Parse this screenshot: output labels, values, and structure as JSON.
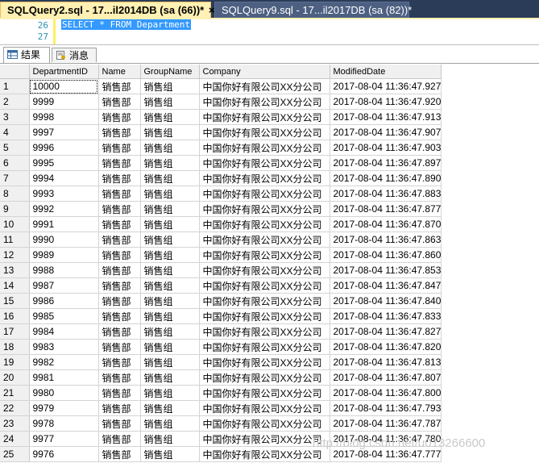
{
  "tabs": {
    "active": {
      "title": "SQLQuery2.sql - 17...il2014DB (sa (66))*",
      "close": "×"
    },
    "inactive": {
      "title": "SQLQuery9.sql - 17...il2017DB (sa (82))*"
    }
  },
  "editor": {
    "lines": [
      {
        "number": "26",
        "text": "SELECT * FROM Department"
      },
      {
        "number": "27",
        "text": ""
      }
    ]
  },
  "result_tabs": [
    {
      "label": "结果",
      "icon": "grid-icon"
    },
    {
      "label": "消息",
      "icon": "messages-icon"
    }
  ],
  "grid": {
    "columns": [
      "",
      "DepartmentID",
      "Name",
      "GroupName",
      "Company",
      "ModifiedDate"
    ],
    "rows": [
      [
        "1",
        "10000",
        "销售部",
        "销售组",
        "中国你好有限公司XX分公司",
        "2017-08-04 11:36:47.927"
      ],
      [
        "2",
        "9999",
        "销售部",
        "销售组",
        "中国你好有限公司XX分公司",
        "2017-08-04 11:36:47.920"
      ],
      [
        "3",
        "9998",
        "销售部",
        "销售组",
        "中国你好有限公司XX分公司",
        "2017-08-04 11:36:47.913"
      ],
      [
        "4",
        "9997",
        "销售部",
        "销售组",
        "中国你好有限公司XX分公司",
        "2017-08-04 11:36:47.907"
      ],
      [
        "5",
        "9996",
        "销售部",
        "销售组",
        "中国你好有限公司XX分公司",
        "2017-08-04 11:36:47.903"
      ],
      [
        "6",
        "9995",
        "销售部",
        "销售组",
        "中国你好有限公司XX分公司",
        "2017-08-04 11:36:47.897"
      ],
      [
        "7",
        "9994",
        "销售部",
        "销售组",
        "中国你好有限公司XX分公司",
        "2017-08-04 11:36:47.890"
      ],
      [
        "8",
        "9993",
        "销售部",
        "销售组",
        "中国你好有限公司XX分公司",
        "2017-08-04 11:36:47.883"
      ],
      [
        "9",
        "9992",
        "销售部",
        "销售组",
        "中国你好有限公司XX分公司",
        "2017-08-04 11:36:47.877"
      ],
      [
        "10",
        "9991",
        "销售部",
        "销售组",
        "中国你好有限公司XX分公司",
        "2017-08-04 11:36:47.870"
      ],
      [
        "11",
        "9990",
        "销售部",
        "销售组",
        "中国你好有限公司XX分公司",
        "2017-08-04 11:36:47.863"
      ],
      [
        "12",
        "9989",
        "销售部",
        "销售组",
        "中国你好有限公司XX分公司",
        "2017-08-04 11:36:47.860"
      ],
      [
        "13",
        "9988",
        "销售部",
        "销售组",
        "中国你好有限公司XX分公司",
        "2017-08-04 11:36:47.853"
      ],
      [
        "14",
        "9987",
        "销售部",
        "销售组",
        "中国你好有限公司XX分公司",
        "2017-08-04 11:36:47.847"
      ],
      [
        "15",
        "9986",
        "销售部",
        "销售组",
        "中国你好有限公司XX分公司",
        "2017-08-04 11:36:47.840"
      ],
      [
        "16",
        "9985",
        "销售部",
        "销售组",
        "中国你好有限公司XX分公司",
        "2017-08-04 11:36:47.833"
      ],
      [
        "17",
        "9984",
        "销售部",
        "销售组",
        "中国你好有限公司XX分公司",
        "2017-08-04 11:36:47.827"
      ],
      [
        "18",
        "9983",
        "销售部",
        "销售组",
        "中国你好有限公司XX分公司",
        "2017-08-04 11:36:47.820"
      ],
      [
        "19",
        "9982",
        "销售部",
        "销售组",
        "中国你好有限公司XX分公司",
        "2017-08-04 11:36:47.813"
      ],
      [
        "20",
        "9981",
        "销售部",
        "销售组",
        "中国你好有限公司XX分公司",
        "2017-08-04 11:36:47.807"
      ],
      [
        "21",
        "9980",
        "销售部",
        "销售组",
        "中国你好有限公司XX分公司",
        "2017-08-04 11:36:47.800"
      ],
      [
        "22",
        "9979",
        "销售部",
        "销售组",
        "中国你好有限公司XX分公司",
        "2017-08-04 11:36:47.793"
      ],
      [
        "23",
        "9978",
        "销售部",
        "销售组",
        "中国你好有限公司XX分公司",
        "2017-08-04 11:36:47.787"
      ],
      [
        "24",
        "9977",
        "销售部",
        "销售组",
        "中国你好有限公司XX分公司",
        "2017-08-04 11:36:47.780"
      ],
      [
        "25",
        "9976",
        "销售部",
        "销售组",
        "中国你好有限公司XX分公司",
        "2017-08-04 11:36:47.777"
      ]
    ]
  },
  "watermark": "http://blog.csdn.net/u013266600",
  "colors": {
    "tab_active": "#fff0b3",
    "tab_strip": "#2b3c59",
    "selection": "#3399ff",
    "keyword": "#0000ff",
    "line_number": "#2b91af"
  }
}
